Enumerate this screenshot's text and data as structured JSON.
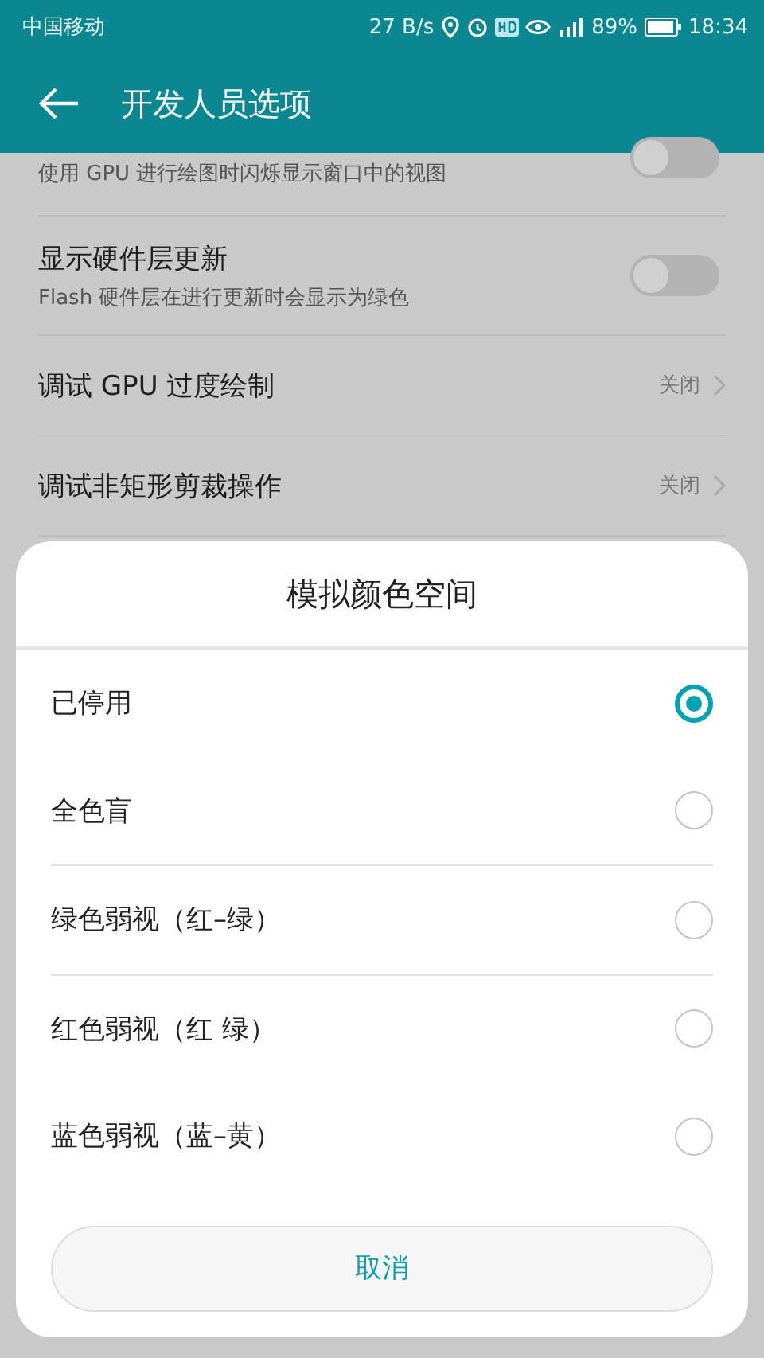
{
  "status_bar": {
    "carrier": "中国移动",
    "speed": "27 B/s",
    "battery": "89%",
    "time": "18:34"
  },
  "app_bar": {
    "title": "开发人员选项"
  },
  "settings": [
    {
      "kind": "toggle",
      "subtitle": "使用 GPU 进行绘图时闪烁显示窗口中的视图",
      "on": false
    },
    {
      "kind": "toggle",
      "title": "显示硬件层更新",
      "subtitle": "Flash 硬件层在进行更新时会显示为绿色",
      "on": false
    },
    {
      "kind": "link",
      "title": "调试 GPU 过度绘制",
      "value": "关闭"
    },
    {
      "kind": "link",
      "title": "调试非矩形剪裁操作",
      "value": "关闭"
    }
  ],
  "dialog": {
    "title": "模拟颜色空间",
    "options": [
      {
        "label": "已停用",
        "selected": true
      },
      {
        "label": "全色盲",
        "selected": false
      },
      {
        "label": "绿色弱视（红–绿）",
        "selected": false
      },
      {
        "label": "红色弱视（红  绿）",
        "selected": false
      },
      {
        "label": "蓝色弱视（蓝–黄）",
        "selected": false
      }
    ],
    "cancel": "取消"
  }
}
